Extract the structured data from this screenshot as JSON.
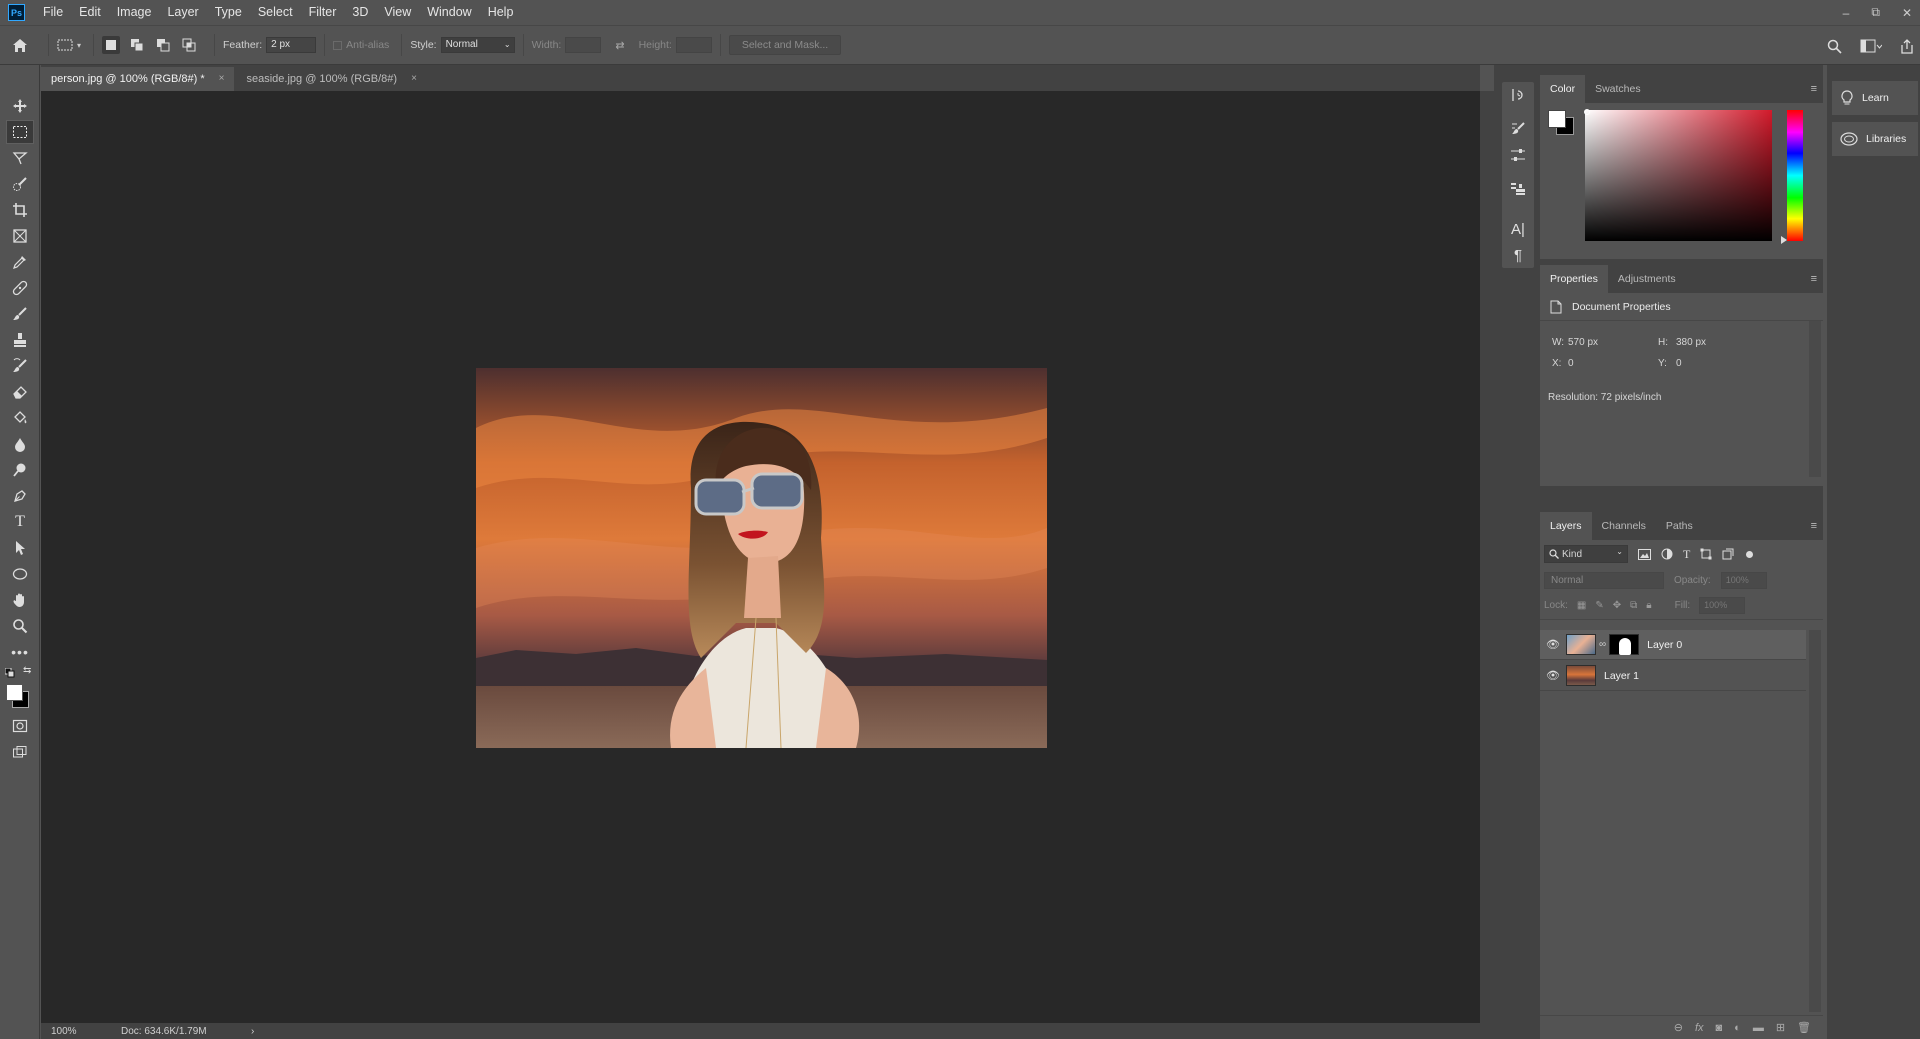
{
  "app": {
    "logo": "Ps"
  },
  "menu": [
    "File",
    "Edit",
    "Image",
    "Layer",
    "Type",
    "Select",
    "Filter",
    "3D",
    "View",
    "Window",
    "Help"
  ],
  "window_controls": {
    "minimize": "–",
    "restore": "⧉",
    "close": "✕"
  },
  "options": {
    "feather_label": "Feather:",
    "feather_value": "2 px",
    "antialias_label": "Anti-alias",
    "style_label": "Style:",
    "style_value": "Normal",
    "width_label": "Width:",
    "height_label": "Height:",
    "select_mask": "Select and Mask..."
  },
  "tabs": [
    {
      "label": "person.jpg @ 100% (RGB/8#) *",
      "close": "×"
    },
    {
      "label": "seaside.jpg @ 100% (RGB/8#)",
      "close": "×"
    }
  ],
  "status": {
    "zoom": "100%",
    "doc": "Doc: 634.6K/1.79M",
    "arrow": "›"
  },
  "color_panel": {
    "tabs": [
      "Color",
      "Swatches"
    ],
    "foreground": "#ffffff",
    "background": "#000000",
    "hue": "#d21a2b"
  },
  "properties": {
    "tabs": [
      "Properties",
      "Adjustments"
    ],
    "header": "Document Properties",
    "w_label": "W:",
    "w_value": "570 px",
    "h_label": "H:",
    "h_value": "380 px",
    "x_label": "X:",
    "x_value": "0",
    "y_label": "Y:",
    "y_value": "0",
    "resolution": "Resolution: 72 pixels/inch"
  },
  "layers": {
    "tabs": [
      "Layers",
      "Channels",
      "Paths"
    ],
    "kind": "Kind",
    "blend": "Normal",
    "opacity_label": "Opacity:",
    "opacity_value": "100%",
    "lock_label": "Lock:",
    "fill_label": "Fill:",
    "fill_value": "100%",
    "items": [
      {
        "name": "Layer 0"
      },
      {
        "name": "Layer 1"
      }
    ]
  },
  "right_dock": {
    "learn": "Learn",
    "libraries": "Libraries"
  }
}
